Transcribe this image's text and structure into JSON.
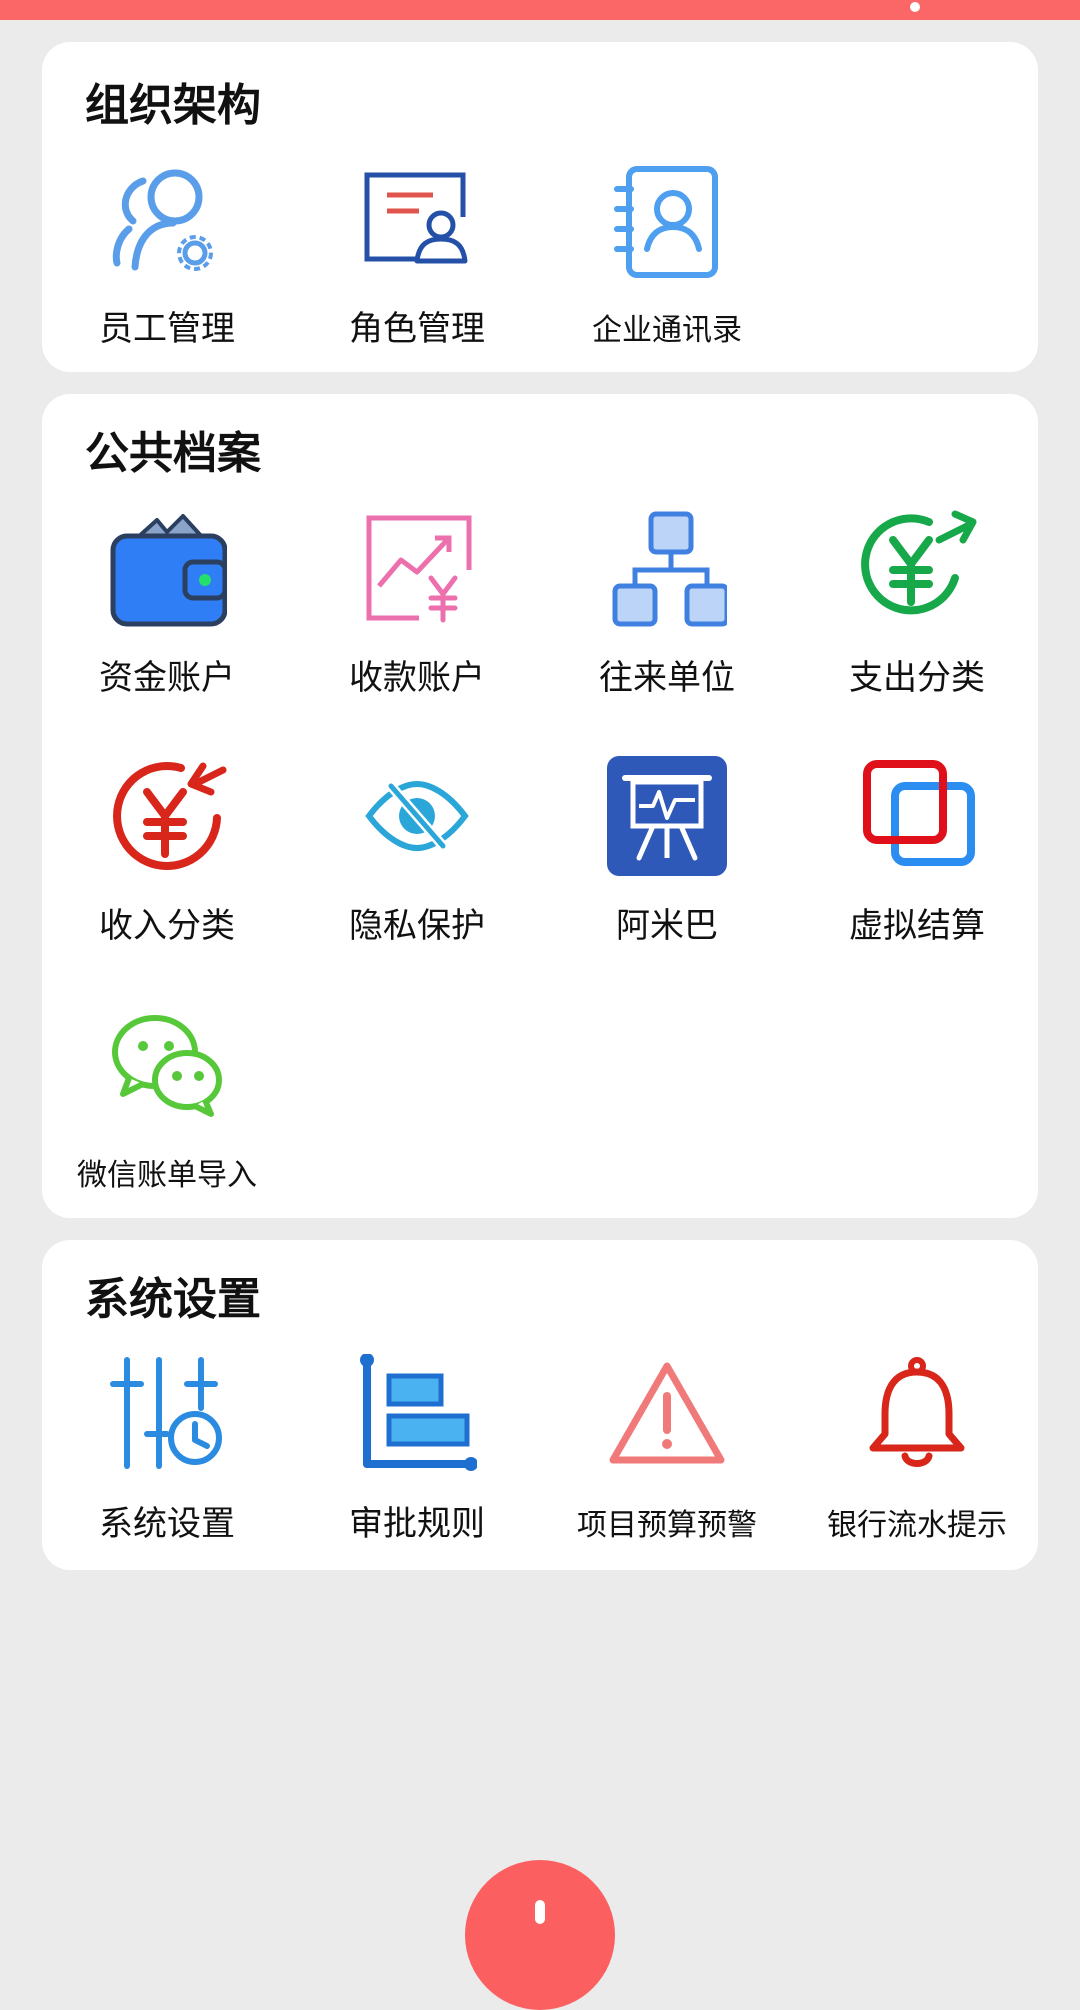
{
  "sections": [
    {
      "title": "组织架构",
      "items": [
        {
          "label": "员工管理",
          "icon": "user-gear-icon"
        },
        {
          "label": "角色管理",
          "icon": "role-card-icon"
        },
        {
          "label": "企业通讯录",
          "icon": "contact-book-icon"
        }
      ]
    },
    {
      "title": "公共档案",
      "items": [
        {
          "label": "资金账户",
          "icon": "wallet-icon"
        },
        {
          "label": "收款账户",
          "icon": "receipt-chart-yen-icon"
        },
        {
          "label": "往来单位",
          "icon": "org-chart-icon"
        },
        {
          "label": "支出分类",
          "icon": "yen-out-icon"
        },
        {
          "label": "收入分类",
          "icon": "yen-in-icon"
        },
        {
          "label": "隐私保护",
          "icon": "eye-slash-icon"
        },
        {
          "label": "阿米巴",
          "icon": "presentation-board-icon"
        },
        {
          "label": "虚拟结算",
          "icon": "overlap-squares-icon"
        },
        {
          "label": "微信账单导入",
          "icon": "wechat-icon"
        }
      ]
    },
    {
      "title": "系统设置",
      "items": [
        {
          "label": "系统设置",
          "icon": "sliders-clock-icon"
        },
        {
          "label": "审批规则",
          "icon": "approval-rules-icon"
        },
        {
          "label": "项目预算预警",
          "icon": "warning-triangle-icon"
        },
        {
          "label": "银行流水提示",
          "icon": "bell-icon"
        }
      ]
    }
  ],
  "colors": {
    "accent": "#fb6666",
    "background": "#ebebeb",
    "card": "#ffffff",
    "blue": "#2f7ef6",
    "green": "#17a84a",
    "red": "#d8261b"
  }
}
